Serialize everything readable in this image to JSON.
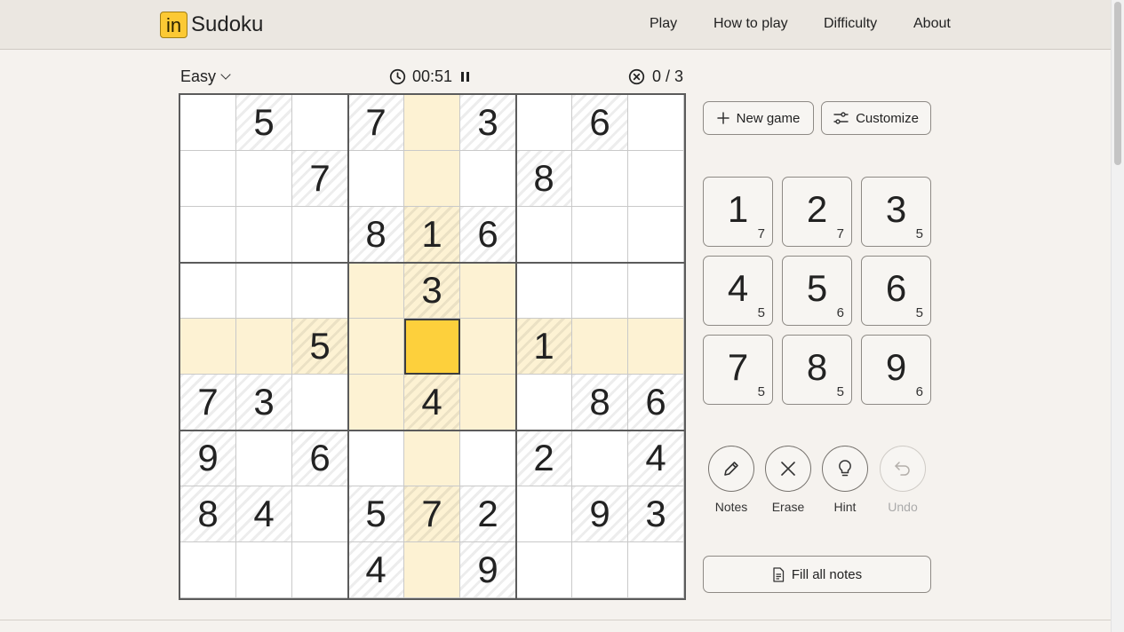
{
  "header": {
    "logo_mark": "in",
    "logo_text": "Sudoku",
    "nav": [
      "Play",
      "How to play",
      "Difficulty",
      "About"
    ]
  },
  "status": {
    "difficulty": "Easy",
    "timer": "00:51",
    "mistakes": "0 / 3"
  },
  "board": {
    "cells": [
      [
        "",
        "5",
        "",
        "7",
        "",
        "3",
        "",
        "6",
        ""
      ],
      [
        "",
        "",
        "7",
        "",
        "",
        "",
        "8",
        "",
        ""
      ],
      [
        "",
        "",
        "",
        "8",
        "1",
        "6",
        "",
        "",
        ""
      ],
      [
        "",
        "",
        "",
        "",
        "3",
        "",
        "",
        "",
        ""
      ],
      [
        "",
        "",
        "5",
        "",
        "",
        "",
        "1",
        "",
        ""
      ],
      [
        "7",
        "3",
        "",
        "",
        "4",
        "",
        "",
        "8",
        "6"
      ],
      [
        "9",
        "",
        "6",
        "",
        "",
        "",
        "2",
        "",
        "4"
      ],
      [
        "8",
        "4",
        "",
        "5",
        "7",
        "2",
        "",
        "9",
        "3"
      ],
      [
        "",
        "",
        "",
        "4",
        "",
        "9",
        "",
        "",
        ""
      ]
    ],
    "selected": [
      4,
      4
    ]
  },
  "actions": {
    "new_game": "New game",
    "customize": "Customize",
    "fill_notes": "Fill all notes"
  },
  "numpad": [
    {
      "digit": "1",
      "count": "7"
    },
    {
      "digit": "2",
      "count": "7"
    },
    {
      "digit": "3",
      "count": "5"
    },
    {
      "digit": "4",
      "count": "5"
    },
    {
      "digit": "5",
      "count": "6"
    },
    {
      "digit": "6",
      "count": "5"
    },
    {
      "digit": "7",
      "count": "5"
    },
    {
      "digit": "8",
      "count": "5"
    },
    {
      "digit": "9",
      "count": "6"
    }
  ],
  "tools": [
    {
      "label": "Notes",
      "icon": "pencil-icon",
      "enabled": true
    },
    {
      "label": "Erase",
      "icon": "close-icon",
      "enabled": true
    },
    {
      "label": "Hint",
      "icon": "lightbulb-icon",
      "enabled": true
    },
    {
      "label": "Undo",
      "icon": "undo-icon",
      "enabled": false
    }
  ],
  "colors": {
    "accent": "#fdd03c",
    "highlight": "#fdf2d3",
    "background": "#f5f2ee"
  }
}
